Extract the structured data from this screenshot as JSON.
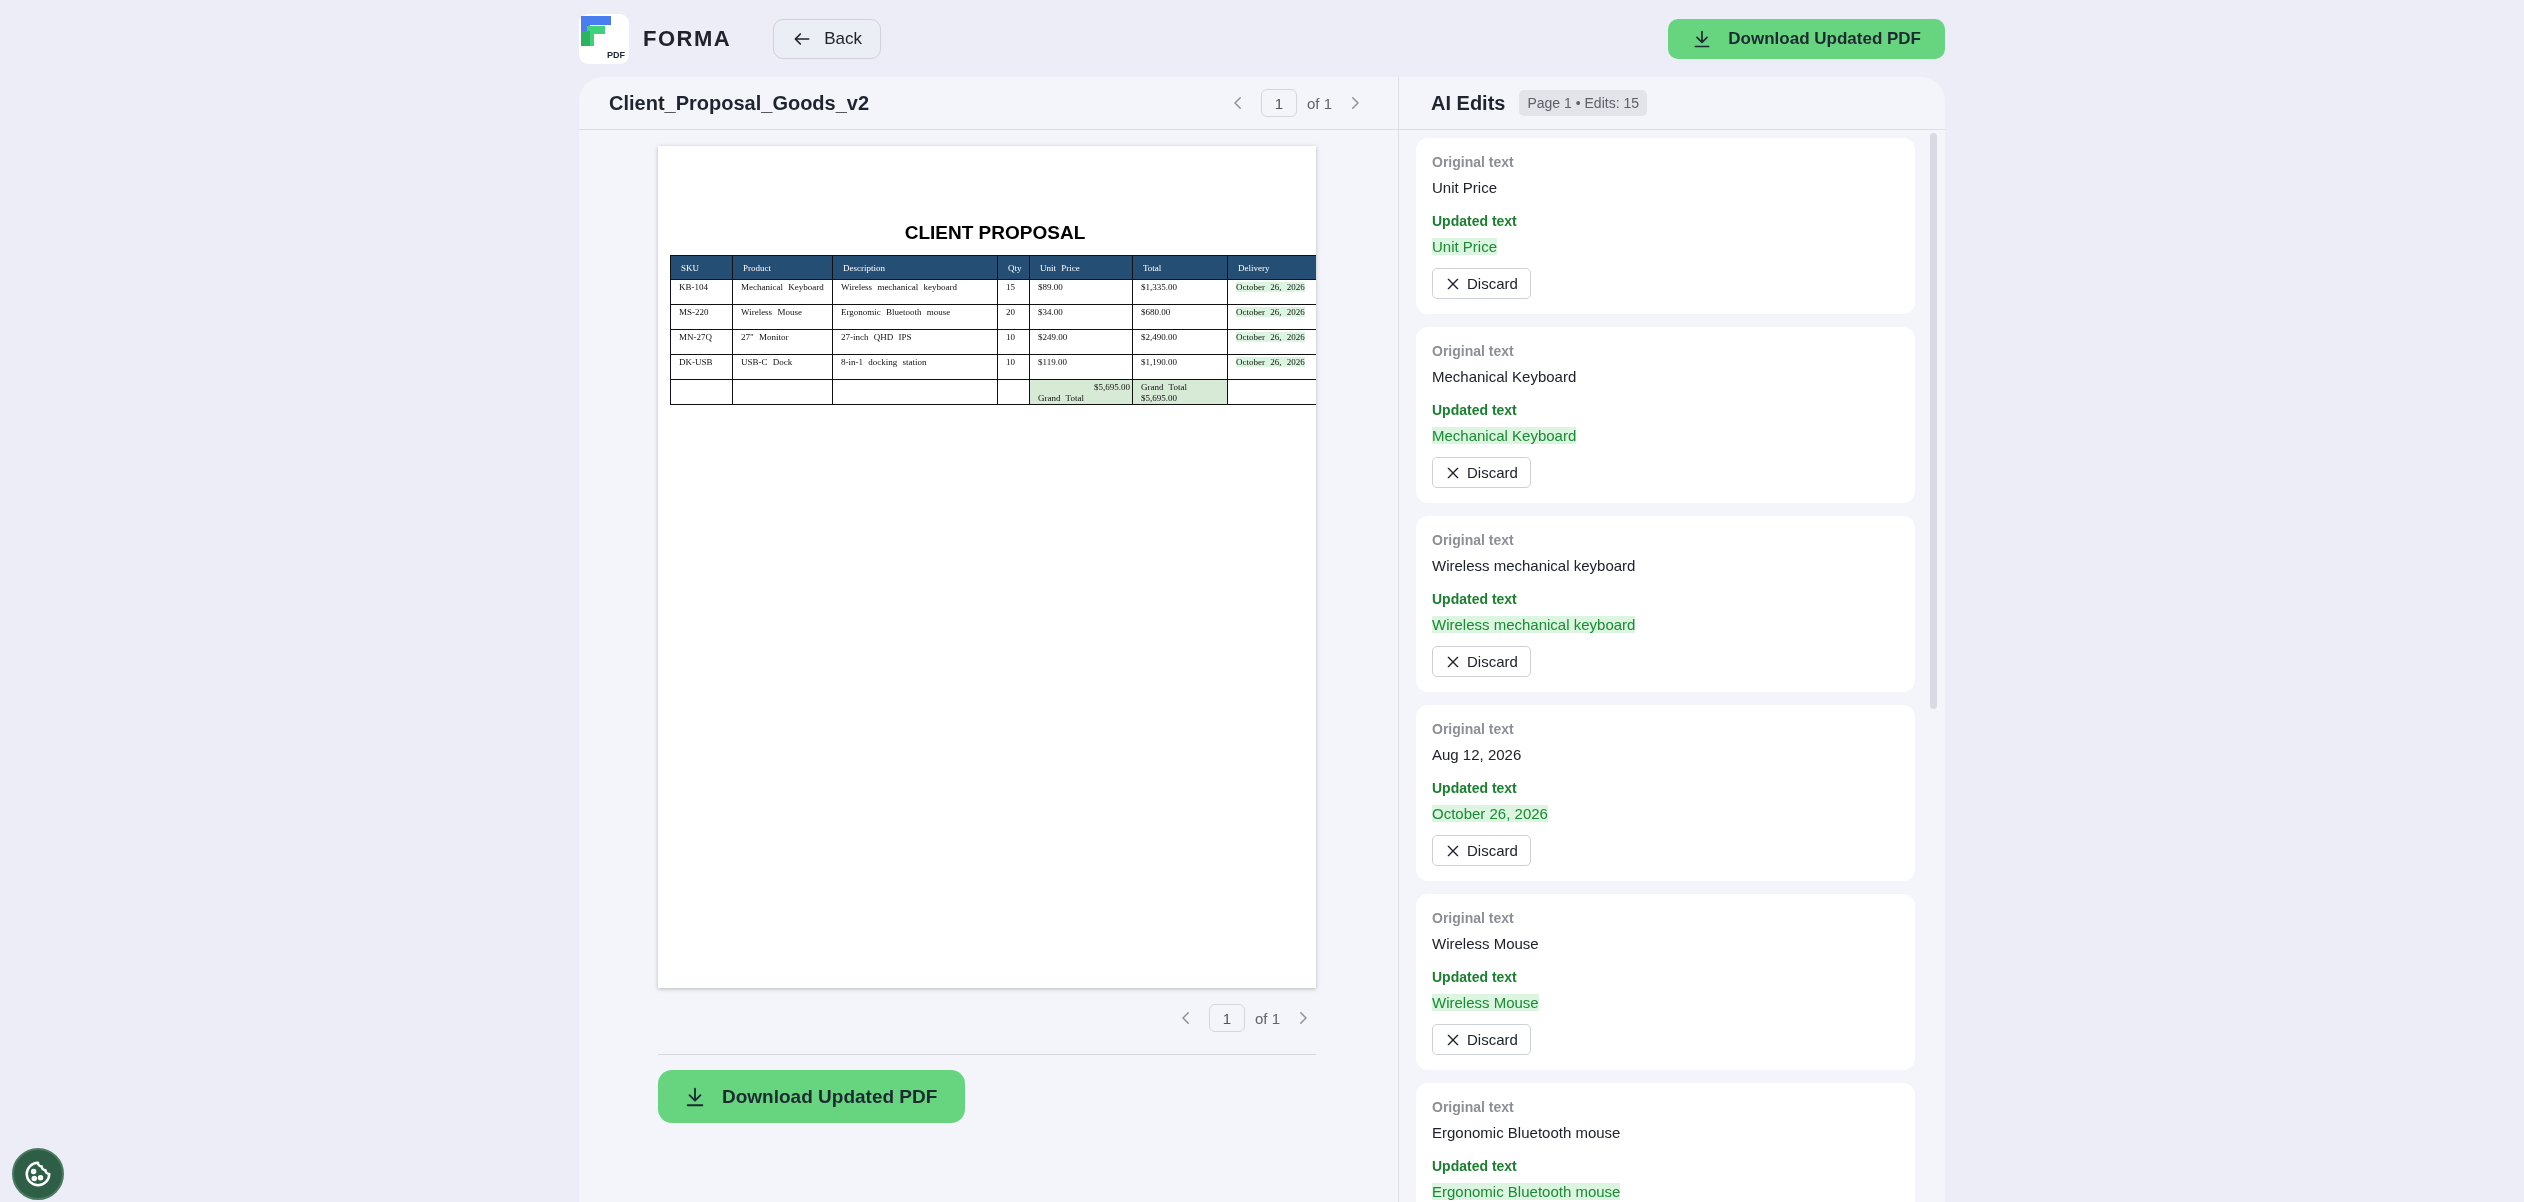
{
  "app": {
    "logo_text": "PDF",
    "brand": "FORMA",
    "back_button": "Back",
    "download_button": "Download Updated PDF"
  },
  "document": {
    "file_name": "Client_Proposal_Goods_v2",
    "pager_top": {
      "page": "1",
      "of": "of 1"
    },
    "page": {
      "title": "CLIENT PROPOSAL",
      "table": {
        "columns": [
          "SKU",
          "Product",
          "Description",
          "Qty",
          "Unit Price",
          "Total",
          "Delivery"
        ],
        "rows": [
          {
            "cells": [
              {
                "text": "KB-104",
                "highlighted": false
              },
              {
                "text": "Mechanical Keyboard",
                "highlighted": false
              },
              {
                "text": "Wireless mechanical keyboard",
                "highlighted": false
              },
              {
                "text": "15",
                "highlighted": false
              },
              {
                "text": "$89.00",
                "highlighted": false
              },
              {
                "text": "$1,335.00",
                "highlighted": false
              },
              {
                "text": "October 26, 2026",
                "highlighted": true
              }
            ]
          },
          {
            "cells": [
              {
                "text": "MS-220",
                "highlighted": false
              },
              {
                "text": "Wireless Mouse",
                "highlighted": false
              },
              {
                "text": "Ergonomic Bluetooth mouse",
                "highlighted": false
              },
              {
                "text": "20",
                "highlighted": false
              },
              {
                "text": "$34.00",
                "highlighted": false
              },
              {
                "text": "$680.00",
                "highlighted": false
              },
              {
                "text": "October 26, 2026",
                "highlighted": true
              }
            ]
          },
          {
            "cells": [
              {
                "text": "MN-27Q",
                "highlighted": false
              },
              {
                "text": "27\" Monitor",
                "highlighted": false
              },
              {
                "text": "27-inch QHD IPS",
                "highlighted": false
              },
              {
                "text": "10",
                "highlighted": false
              },
              {
                "text": "$249.00",
                "highlighted": false
              },
              {
                "text": "$2,490.00",
                "highlighted": false
              },
              {
                "text": "October 26, 2026",
                "highlighted": true
              }
            ]
          },
          {
            "cells": [
              {
                "text": "DK-USB",
                "highlighted": false
              },
              {
                "text": "USB-C Dock",
                "highlighted": false
              },
              {
                "text": "8-in-1 docking station",
                "highlighted": false
              },
              {
                "text": "10",
                "highlighted": false
              },
              {
                "text": "$119.00",
                "highlighted": false
              },
              {
                "text": "$1,190.00",
                "highlighted": false
              },
              {
                "text": "October 26, 2026",
                "highlighted": true
              }
            ]
          },
          {
            "cells": [
              {
                "highlighted": false
              },
              {
                "highlighted": false
              },
              {
                "highlighted": false
              },
              {
                "highlighted": false
              },
              {
                "text": "$5,695.00",
                "note": "Grand Total",
                "highlighted": true
              },
              {
                "text": "Grand Total $5,695.00",
                "highlighted": true
              },
              {
                "highlighted": false
              }
            ]
          }
        ]
      }
    },
    "pager_bottom": {
      "page": "1",
      "of": "of 1"
    },
    "download_button": "Download Updated PDF"
  },
  "edits_panel": {
    "title": "AI Edits",
    "badge": "Page 1 • Edits: 15",
    "edits": [
      {
        "original_label": "Original text",
        "original": "Unit Price",
        "updated_label": "Updated text",
        "updated": "Unit Price",
        "discard": "Discard"
      },
      {
        "original_label": "Original text",
        "original": "Mechanical Keyboard",
        "updated_label": "Updated text",
        "updated": "Mechanical Keyboard",
        "discard": "Discard"
      },
      {
        "original_label": "Original text",
        "original": "Wireless mechanical keyboard",
        "updated_label": "Updated text",
        "updated": "Wireless mechanical keyboard",
        "discard": "Discard"
      },
      {
        "original_label": "Original text",
        "original": "Aug 12, 2026",
        "updated_label": "Updated text",
        "updated": "October 26, 2026",
        "discard": "Discard"
      },
      {
        "original_label": "Original text",
        "original": "Wireless Mouse",
        "updated_label": "Updated text",
        "updated": "Wireless Mouse",
        "discard": "Discard"
      },
      {
        "original_label": "Original text",
        "original": "Ergonomic Bluetooth mouse",
        "updated_label": "Updated text",
        "updated": "Ergonomic Bluetooth mouse"
      }
    ]
  }
}
